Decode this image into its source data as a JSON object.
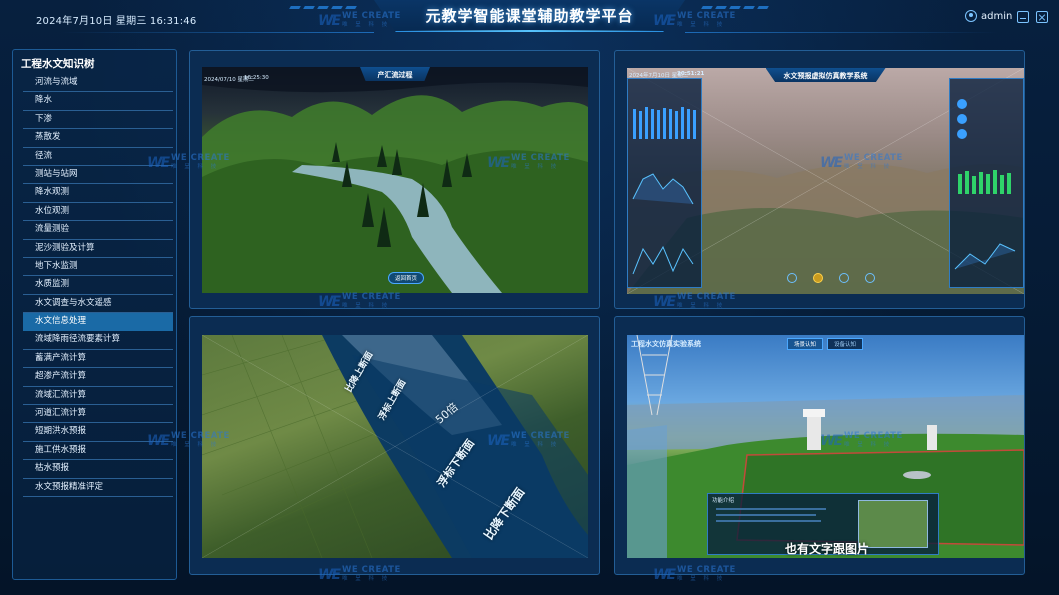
{
  "header": {
    "datetime": "2024年7月10日 星期三 16:31:46",
    "title": "元教学智能课堂辅助教学平台",
    "username": "admin"
  },
  "watermark": {
    "text": "WE CREATE",
    "subtext": "唯 呈 科 技",
    "mark": "WE"
  },
  "sidebar": {
    "title": "工程水文知识树",
    "active_index": 13,
    "items": [
      "河流与流域",
      "降水",
      "下渗",
      "蒸散发",
      "径流",
      "测站与站网",
      "降水观测",
      "水位观测",
      "流量测验",
      "泥沙测验及计算",
      "地下水监测",
      "水质监测",
      "水文调查与水文遥感",
      "水文信息处理",
      "流域降雨径流要素计算",
      "蓄满产流计算",
      "超渗产流计算",
      "流域汇流计算",
      "河道汇流计算",
      "短期洪水预报",
      "施工供水预报",
      "枯水预报",
      "水文预报精准评定"
    ]
  },
  "panels": {
    "p1": {
      "title": "产汇流过程",
      "top_left": "2024/07/10 星期三",
      "top_time": "16:25:30",
      "button": "返回首页"
    },
    "p2": {
      "title": "水文预报虚拟仿真教学系统",
      "top_left": "2024年7月10日 星期三",
      "top_time": "20:51:21"
    },
    "p3": {
      "label_upper": "比降上断面",
      "label_float_upper": "浮标上断面",
      "label_distance": "50倍",
      "label_float_lower": "浮标下断面",
      "label_lower": "比降下断面"
    },
    "p4": {
      "title": "工程水文仿真实验系统",
      "tabs": [
        "场景认知",
        "设备认知"
      ],
      "caption": "也有文字跟图片",
      "popup_title": "功能介绍"
    }
  },
  "colors": {
    "accent": "#1a6aa6",
    "border": "#235e96",
    "background": "#061a33"
  }
}
